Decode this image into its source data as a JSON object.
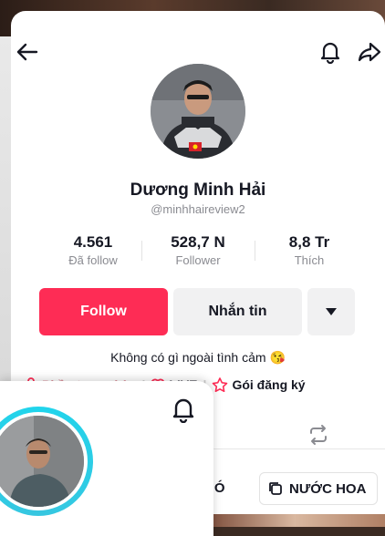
{
  "profile": {
    "name": "Dương Minh Hải",
    "handle": "@minhhaireview2",
    "bio": "Không có gì ngoài tình cảm 😘"
  },
  "stats": [
    {
      "value": "4.561",
      "label": "Đã follow"
    },
    {
      "value": "528,7 N",
      "label": "Follower"
    },
    {
      "value": "8,8 Tr",
      "label": "Thích"
    }
  ],
  "actions": {
    "follow": "Follow",
    "message": "Nhắn tin"
  },
  "links": {
    "showcase": "Phần trưng bày",
    "live": "LIVE",
    "subscription": "Gói đăng ký"
  },
  "chips": {
    "partial": "HÓ",
    "perfume": "NƯỚC HOA"
  },
  "colors": {
    "accent": "#fe2c55",
    "ring": "#20d5ec",
    "text": "#161823",
    "secondary": "#8a8b91"
  },
  "icons": [
    "back-arrow-icon",
    "bell-icon",
    "share-icon",
    "dropdown-caret-icon",
    "shop-icon",
    "live-icon",
    "subscription-star-icon",
    "repost-icon",
    "collection-icon"
  ]
}
